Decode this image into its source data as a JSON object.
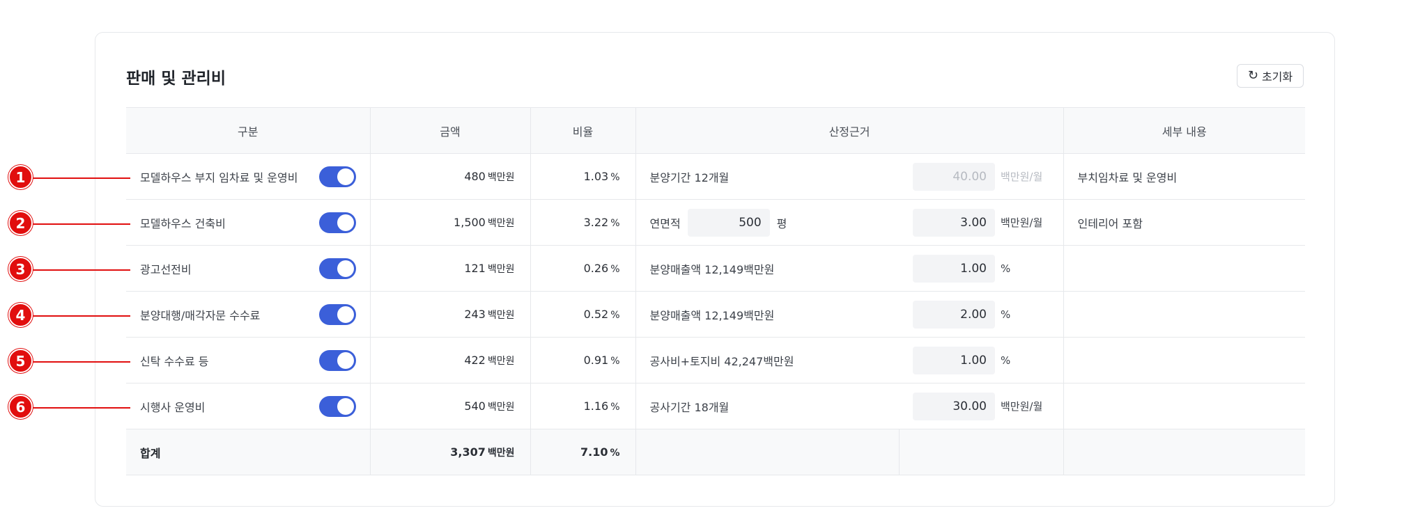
{
  "panel": {
    "title": "판매 및 관리비",
    "reset_label": "초기화",
    "reset_icon": "refresh-icon"
  },
  "table": {
    "headers": {
      "category": "구분",
      "amount": "금액",
      "ratio": "비율",
      "basis": "산정근거",
      "detail": "세부 내용"
    },
    "amount_unit": "백만원",
    "ratio_unit": "%",
    "rows": [
      {
        "marker": "1",
        "name": "모델하우스 부지 임차료 및 운영비",
        "amount": "480",
        "ratio": "1.03",
        "basis": "분양기간 12개월",
        "rate_value": "40.00",
        "rate_unit": "백만원/월",
        "detail": "부치임차료 및 운영비"
      },
      {
        "marker": "2",
        "name": "모델하우스 건축비",
        "amount": "1,500",
        "ratio": "3.22",
        "basis_label": "연면적",
        "basis_value": "500",
        "basis_unit": "평",
        "rate_value": "3.00",
        "rate_unit": "백만원/월",
        "detail": "인테리어 포함"
      },
      {
        "marker": "3",
        "name": "광고선전비",
        "amount": "121",
        "ratio": "0.26",
        "basis": "분양매출액 12,149백만원",
        "rate_value": "1.00",
        "rate_unit": "%",
        "detail": ""
      },
      {
        "marker": "4",
        "name": "분양대행/매각자문 수수료",
        "amount": "243",
        "ratio": "0.52",
        "basis": "분양매출액 12,149백만원",
        "rate_value": "2.00",
        "rate_unit": "%",
        "detail": ""
      },
      {
        "marker": "5",
        "name": "신탁 수수료 등",
        "amount": "422",
        "ratio": "0.91",
        "basis": "공사비+토지비 42,247백만원",
        "rate_value": "1.00",
        "rate_unit": "%",
        "detail": ""
      },
      {
        "marker": "6",
        "name": "시행사 운영비",
        "amount": "540",
        "ratio": "1.16",
        "basis": "공사기간 18개월",
        "rate_value": "30.00",
        "rate_unit": "백만원/월",
        "detail": ""
      }
    ],
    "total": {
      "label": "합계",
      "amount": "3,307",
      "ratio": "7.10"
    }
  },
  "colors": {
    "toggle_on": "#3b5fd9",
    "marker": "#e10e0e",
    "header_bg": "#f8f9fa"
  }
}
